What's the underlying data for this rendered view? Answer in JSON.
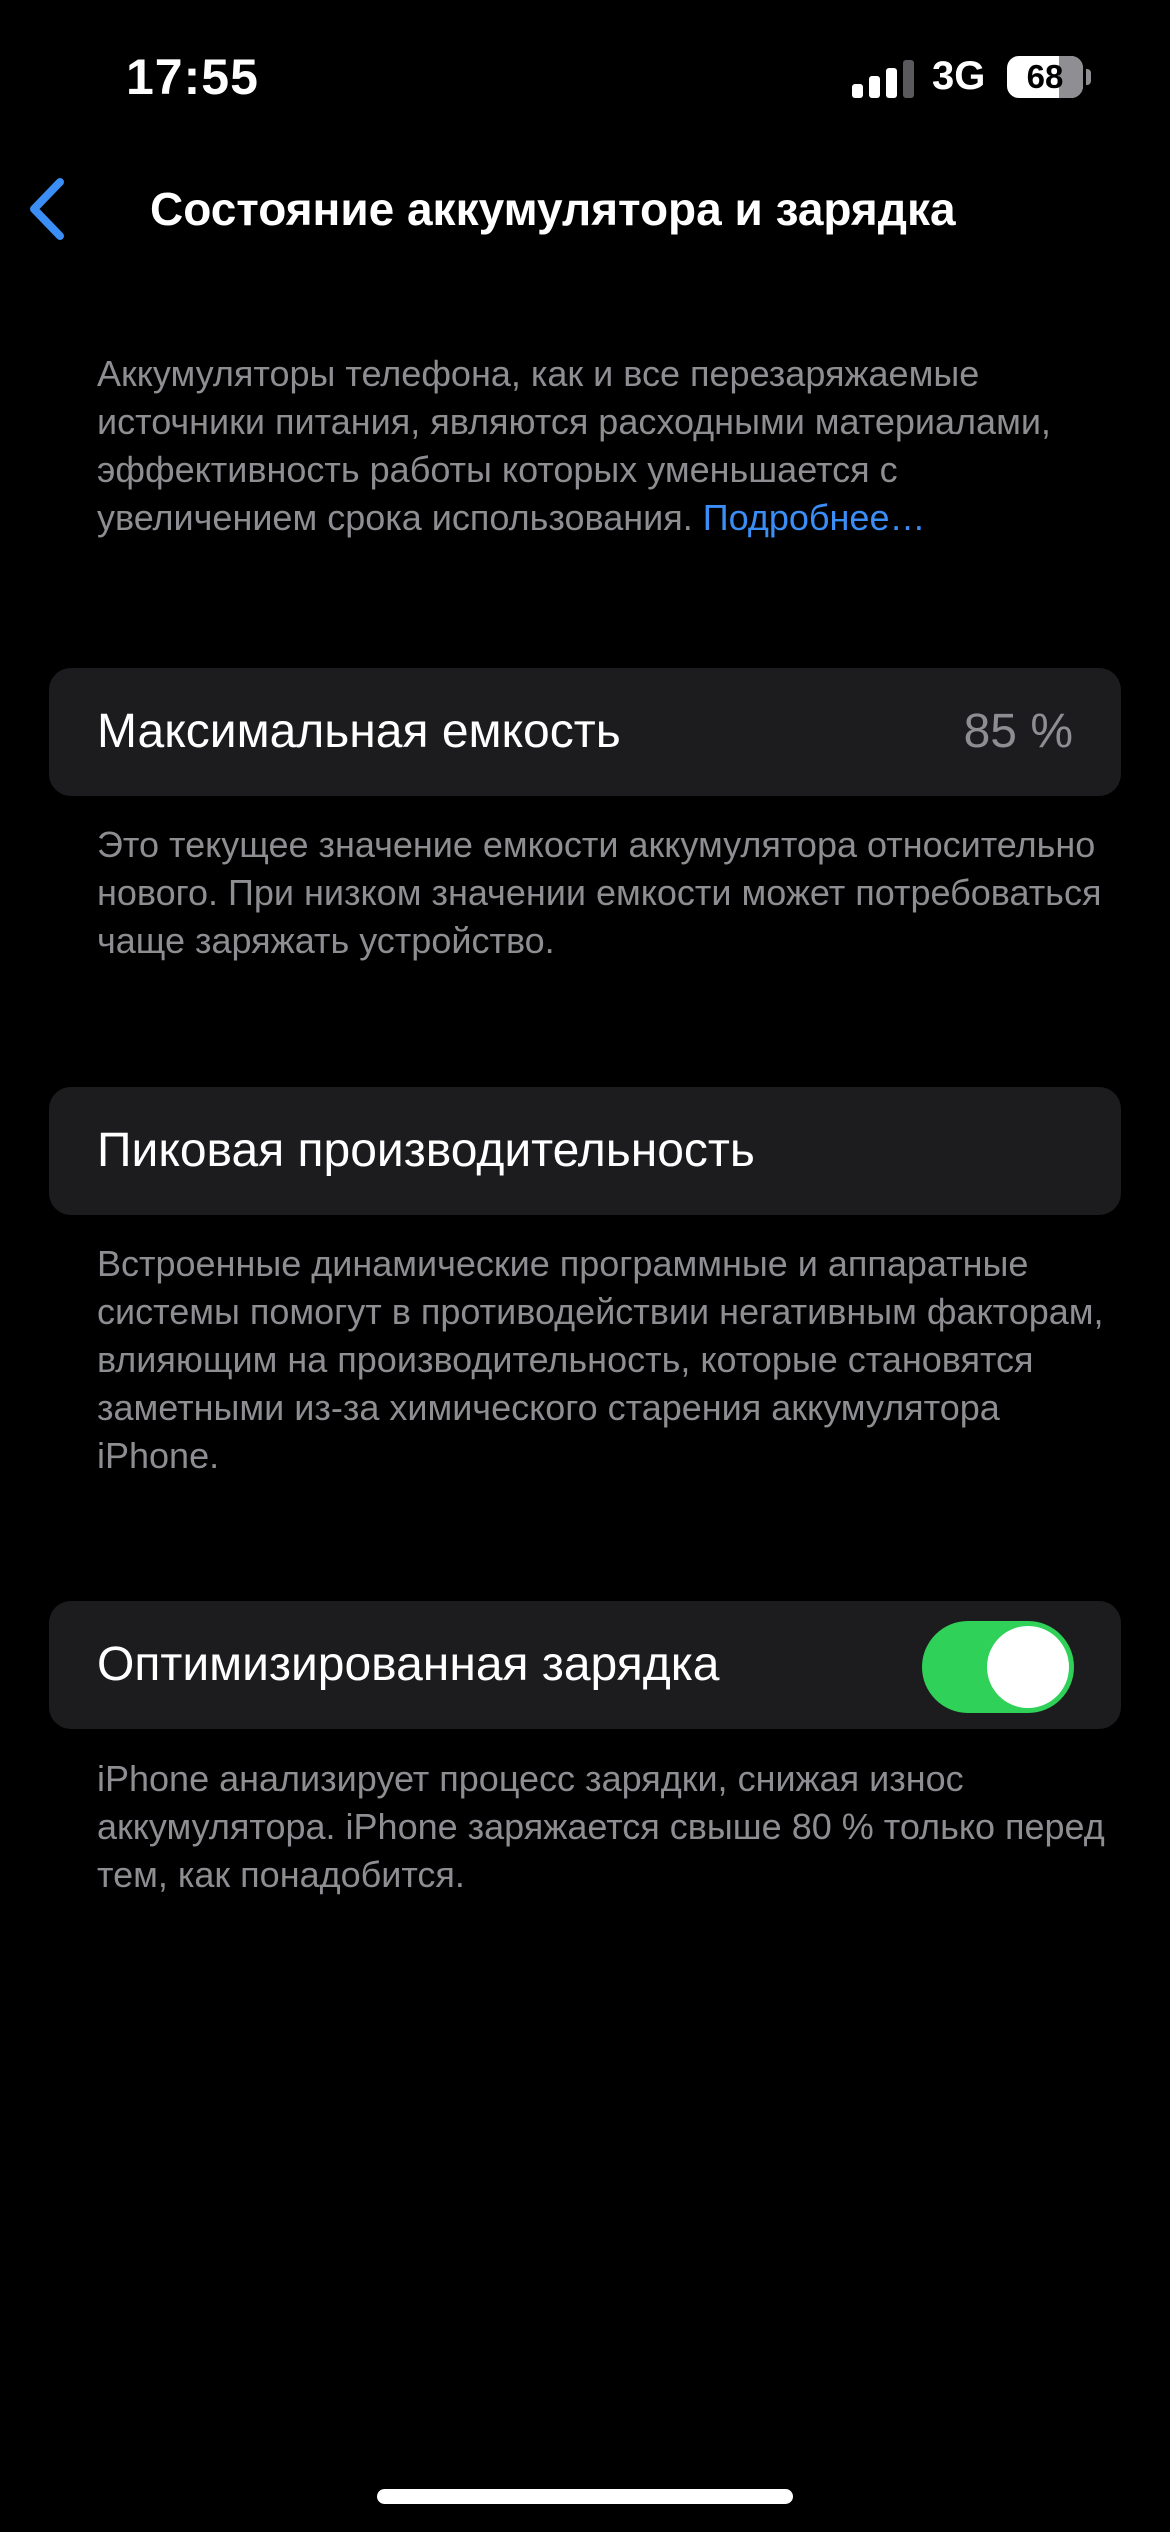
{
  "status_bar": {
    "time": "17:55",
    "network": "3G",
    "battery_level": "68",
    "battery_fraction": 0.68,
    "signal_icon": "cellular-signal-icon",
    "signal_bars_active": 3,
    "signal_bars_total": 4
  },
  "nav": {
    "back_icon": "chevron-left-icon",
    "title": "Состояние аккумулятора и зарядка"
  },
  "intro": {
    "text": "Аккумуляторы телефона, как и все перезаряжаемые источники питания, являются расходными материалами, эффективность работы которых уменьшается с увеличением срока использования. ",
    "link": "Подробнее…"
  },
  "max_capacity": {
    "label": "Максимальная емкость",
    "value": "85 %",
    "description": "Это текущее значение емкости аккумулятора относительно нового. При низком значении емкости может потребоваться чаще заряжать устройство."
  },
  "peak_performance": {
    "label": "Пиковая производительность",
    "description": "Встроенные динамические программные и аппаратные системы помогут в противодействии негативным факторам, влияющим на производительность, которые становятся заметными из-за химического старения аккумулятора iPhone."
  },
  "optimized_charging": {
    "label": "Оптимизированная зарядка",
    "enabled": true,
    "description": "iPhone анализирует процесс зарядки, снижая износ аккумулятора. iPhone заряжается свыше 80 % только перед тем, как понадобится."
  },
  "colors": {
    "background": "#000000",
    "cell_background": "#1c1c1e",
    "secondary_text": "#8d8d92",
    "link": "#3a8ef6",
    "toggle_on": "#30d158",
    "signal_active": "#ffffff",
    "signal_inactive": "#5a5a5e"
  }
}
